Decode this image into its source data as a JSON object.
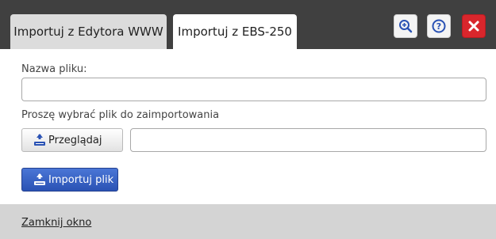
{
  "tabs": [
    {
      "label": "Importuj z Edytora WWW",
      "active": false
    },
    {
      "label": "Importuj z EBS-250",
      "active": true
    }
  ],
  "header_buttons": {
    "zoom_icon": "zoom-in-icon",
    "help_icon": "help-icon",
    "close_icon": "close-icon"
  },
  "form": {
    "filename_label": "Nazwa pliku:",
    "filename_value": "",
    "choose_label": "Proszę wybrać plik do zaimportowania",
    "file_path_value": ""
  },
  "buttons": {
    "browse_label": "Przeglądaj",
    "import_label": "Importuj plik"
  },
  "footer": {
    "close_link": "Zamknij okno"
  },
  "colors": {
    "header_bg": "#404040",
    "close_button": "#d9262c",
    "import_button": "#2a52b4",
    "footer_bg": "#d4d4d4"
  }
}
